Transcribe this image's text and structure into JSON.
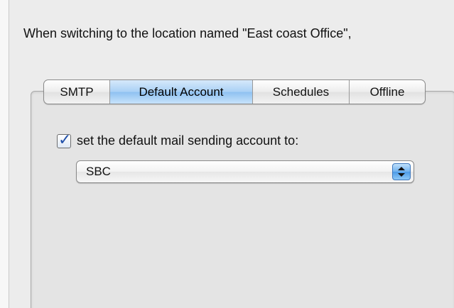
{
  "intro": {
    "text": "When switching to the location named \"East coast Office\","
  },
  "tabs": [
    {
      "label": "SMTP",
      "selected": false
    },
    {
      "label": "Default Account",
      "selected": true
    },
    {
      "label": "Schedules",
      "selected": false
    },
    {
      "label": "Offline",
      "selected": false
    }
  ],
  "default_account": {
    "checkbox_checked": true,
    "checkbox_label": "set the default mail sending account to:",
    "popup_value": "SBC",
    "popup_icon": "stepper-arrows-icon"
  },
  "colors": {
    "selected_tab": "#a9d0f5",
    "check": "#1f4fa8",
    "popup_arrows": "#4d9ae6"
  }
}
